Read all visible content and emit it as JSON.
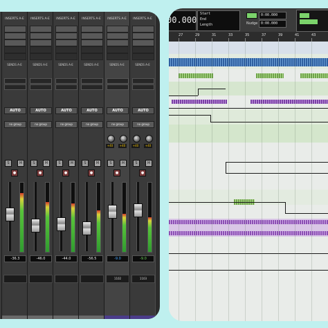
{
  "mixer": {
    "strips": [
      {
        "insert_header": "INSERTS A-E",
        "inserts": [
          "",
          "",
          "",
          "",
          ""
        ],
        "sends_header": "SENDS A-E",
        "auto": "AUTO",
        "group": "no group",
        "volume": "-36.3",
        "volume_style": "normal",
        "meter_level": 0.85,
        "fader_level": 0.55,
        "name": ""
      },
      {
        "insert_header": "INSERTS A-E",
        "inserts": [
          "",
          "",
          "",
          "",
          ""
        ],
        "sends_header": "SENDS A-E",
        "auto": "AUTO",
        "group": "no group",
        "volume": "-46.0",
        "volume_style": "normal",
        "meter_level": 0.72,
        "fader_level": 0.35,
        "name": ""
      },
      {
        "insert_header": "INSERTS A-E",
        "inserts": [
          "",
          "",
          "",
          "",
          ""
        ],
        "sends_header": "SENDS A-E",
        "auto": "AUTO",
        "group": "no group",
        "volume": "-44.0",
        "volume_style": "normal",
        "meter_level": 0.7,
        "fader_level": 0.38,
        "name": ""
      },
      {
        "insert_header": "INSERTS A-E",
        "inserts": [
          "",
          "",
          "",
          "",
          ""
        ],
        "sends_header": "SENDS A-E",
        "auto": "AUTO",
        "group": "no group",
        "volume": "-56.5",
        "volume_style": "normal",
        "meter_level": 0.6,
        "fader_level": 0.3,
        "name": ""
      },
      {
        "insert_header": "INSERTS A-E",
        "inserts": [
          "",
          "",
          "",
          "",
          ""
        ],
        "sends_header": "SENDS A-E",
        "auto": "AUTO",
        "group": "no group",
        "volume": "-9.0",
        "volume_style": "blue",
        "meter_level": 0.55,
        "fader_level": 0.6,
        "name": "1102",
        "knobs": [
          "+40",
          "+40"
        ]
      },
      {
        "insert_header": "INSERTS A-E",
        "inserts": [
          "",
          "",
          "",
          "",
          ""
        ],
        "sends_header": "SENDS A-E",
        "auto": "AUTO",
        "group": "no group",
        "volume": "-9.0",
        "volume_style": "green",
        "meter_level": 0.5,
        "fader_level": 0.62,
        "name": "1103",
        "knobs": [
          "+40",
          "+40"
        ]
      }
    ]
  },
  "edit": {
    "counters": {
      "main_time": "00.000",
      "start_label": "Start",
      "end_label": "End",
      "length_label": "Length",
      "nudge_label": "Nudge",
      "grid_label": "Grid",
      "grid_value": "0:00.000",
      "nudge_value": "0:00.000"
    },
    "ruler_bars": [
      "27",
      "29",
      "31",
      "33",
      "35",
      "37",
      "39",
      "41",
      "43",
      "45",
      "47"
    ]
  },
  "colors": {
    "background": "#bff0ef",
    "mixer_bg": "#2b2b2b",
    "edit_bg": "#e9ece9",
    "clip_blue": "#3b6fb0",
    "clip_green": "#8ec06a",
    "clip_purple": "#a26cc6",
    "lane_green": "#cfe4c6",
    "lane_lilac": "#d9c6e6"
  }
}
